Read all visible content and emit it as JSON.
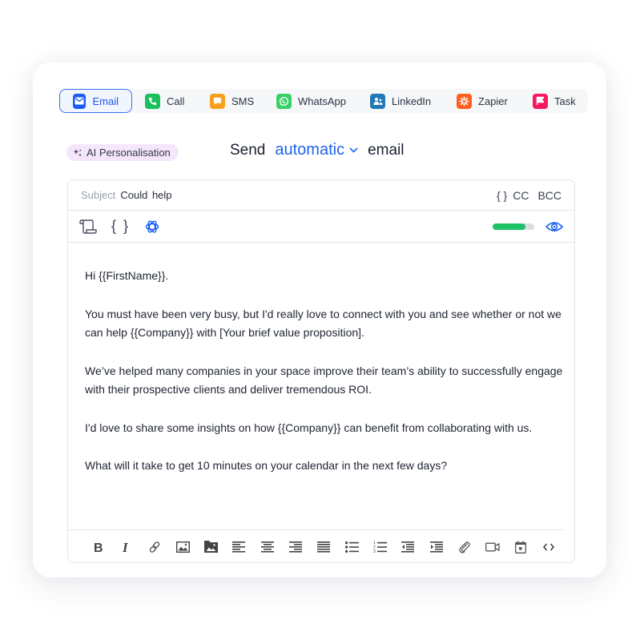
{
  "channels": {
    "active": "Email",
    "items": [
      {
        "label": "Email",
        "icon": "mail-icon",
        "color": "#1a5cf5"
      },
      {
        "label": "Call",
        "icon": "phone-icon",
        "color": "#19c05c"
      },
      {
        "label": "SMS",
        "icon": "message-icon",
        "color": "#f99f1e"
      },
      {
        "label": "WhatsApp",
        "icon": "whatsapp-icon",
        "color": "#38d166"
      },
      {
        "label": "LinkedIn",
        "icon": "linkedin-icon",
        "color": "#2279b5"
      },
      {
        "label": "Zapier",
        "icon": "zapier-icon",
        "color": "#ff5f1f"
      },
      {
        "label": "Task",
        "icon": "flag-icon",
        "color": "#f7195e"
      }
    ]
  },
  "ai_pill": {
    "label": "AI Personalisation"
  },
  "send": {
    "prefix": "Send",
    "mode": "automatic",
    "suffix": "email"
  },
  "subject": {
    "label": "Subject",
    "value": "Could  help",
    "variables": "{ }",
    "cc": "CC",
    "bcc": "BCC"
  },
  "tools": {
    "variables": "{ }",
    "quality_score": 0.78
  },
  "body": {
    "paragraphs": [
      "Hi {{FirstName}}.",
      "You must have been very busy, but I'd really love to connect with you and see whether or not we can help {{Company}} with [Your brief value proposition].",
      "We’ve helped many companies in your space improve their team’s ability to successfully engage with their prospective clients and deliver tremendous ROI.",
      "I'd love to share some insights on how {{Company}} can benefit from collaborating with us.",
      "What will it take to get 10 minutes on your calendar in the next few days?"
    ]
  },
  "format_toolbar": [
    "bold",
    "italic",
    "link",
    "image",
    "image-folder",
    "align-left",
    "align-center",
    "align-right",
    "align-justify",
    "bullet-list",
    "numbered-list",
    "outdent",
    "indent",
    "attachment",
    "video",
    "calendar",
    "code"
  ]
}
